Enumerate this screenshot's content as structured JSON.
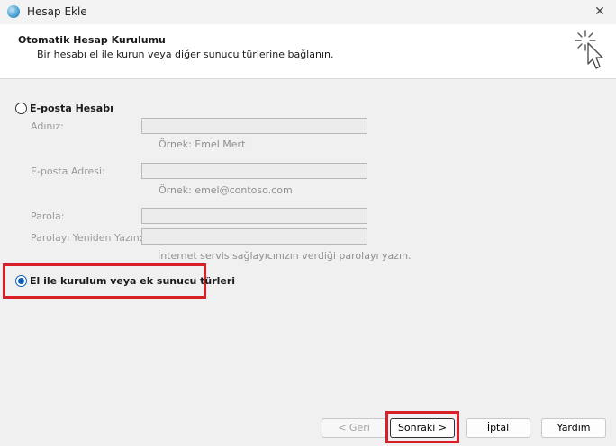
{
  "window": {
    "title": "Hesap Ekle",
    "close_glyph": "✕"
  },
  "header": {
    "title": "Otomatik Hesap Kurulumu",
    "subtitle": "Bir hesabı el ile kurun veya diğer sunucu türlerine bağlanın."
  },
  "email_option": {
    "label": "E-posta Hesabı",
    "selected": false,
    "fields": {
      "name_label": "Adınız:",
      "name_value": "",
      "name_hint": "Örnek: Emel Mert",
      "email_label": "E-posta Adresi:",
      "email_value": "",
      "email_hint": "Örnek: emel@contoso.com",
      "password_label": "Parola:",
      "password_value": "",
      "retype_label": "Parolayı Yeniden Yazın:",
      "retype_value": "",
      "password_hint": "İnternet servis sağlayıcınızın verdiği parolayı yazın."
    }
  },
  "manual_option": {
    "label": "El ile kurulum veya ek sunucu türleri",
    "selected": true
  },
  "buttons": {
    "back": "< Geri",
    "next": "Sonraki >",
    "cancel": "İptal",
    "help": "Yardım"
  },
  "colors": {
    "accent": "#0a5fb4",
    "highlight": "#d72027"
  },
  "icons": {
    "app": "outlook-globe-icon",
    "wizard": "cursor-sparkle-icon"
  }
}
